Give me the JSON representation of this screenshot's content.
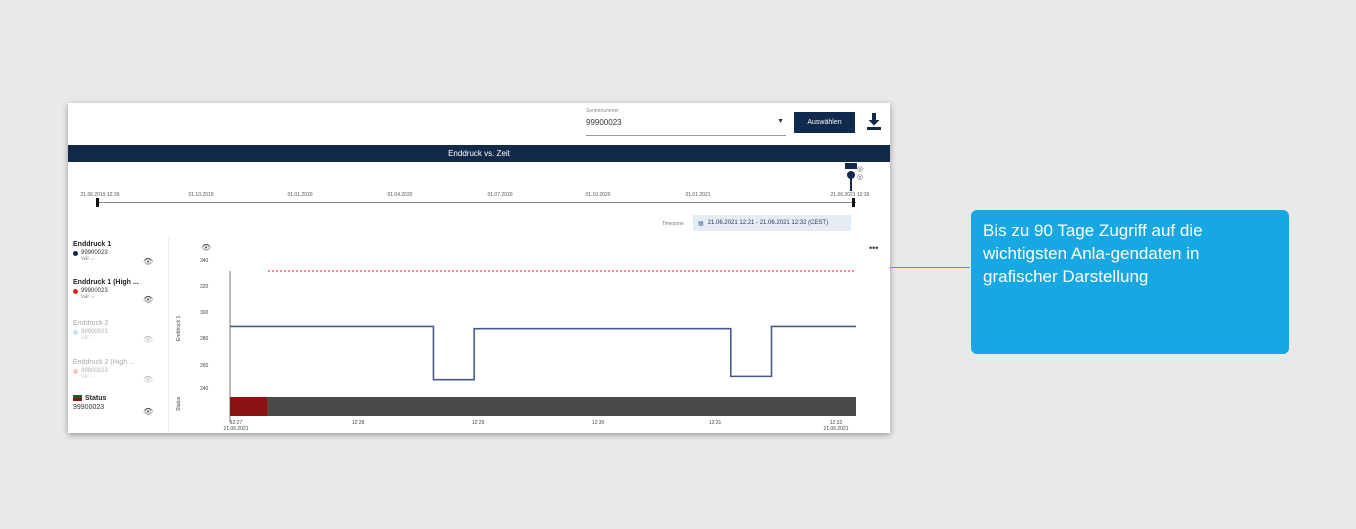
{
  "header": {
    "serial_label": "Seriennummer",
    "serial_value": "99900023",
    "select_button": "Auswählen",
    "download_icon": "download-icon"
  },
  "chart_title": "Enddruck vs. Zeit",
  "timeline": {
    "ticks": [
      "21.06.2019 12:39",
      "01.10.2019",
      "01.01.2020",
      "01.04.2020",
      "01.07.2020",
      "01.10.2020",
      "01.01.2021",
      "21.06.2021 12:39"
    ],
    "timezone_label": "Timezone",
    "range": "21.06.2021 12:21 - 21.06.2021 12:32 (CEST)"
  },
  "legend": {
    "items": [
      {
        "title": "Enddruck 1",
        "serial": "99900023",
        "sub": "val",
        "color": "#0f2a4d",
        "active": true
      },
      {
        "title": "Enddruck 1 (High ...",
        "serial": "99900023",
        "sub": "val",
        "color": "#e0261b",
        "active": true
      },
      {
        "title": "Enddruck 2",
        "serial": "99900023",
        "sub": "val",
        "color": "#6fb7e0",
        "active": false
      },
      {
        "title": "Enddruck 2 (High ...",
        "serial": "99900023",
        "sub": "val",
        "color": "#e86a6a",
        "active": false
      }
    ],
    "status": {
      "title": "Status",
      "serial": "99900023"
    }
  },
  "chart_data": {
    "type": "line",
    "ylabel": "Enddruck 1",
    "status_label": "Status",
    "yticks": [
      "240",
      "260",
      "280",
      "300",
      "320",
      "340"
    ],
    "xticks": [
      {
        "label": "12:27",
        "date": "21.06.2021"
      },
      {
        "label": "12:28",
        "date": ""
      },
      {
        "label": "12:29",
        "date": ""
      },
      {
        "label": "12:30",
        "date": ""
      },
      {
        "label": "12:31",
        "date": ""
      },
      {
        "label": "12:32",
        "date": "21.06.2021"
      }
    ],
    "ylim": [
      240,
      350
    ],
    "threshold": 350,
    "series": [
      {
        "color": "#4a5a8a",
        "points": [
          {
            "t": 0.0,
            "v": 300
          },
          {
            "t": 0.325,
            "v": 300
          },
          {
            "t": 0.325,
            "v": 252
          },
          {
            "t": 0.39,
            "v": 252
          },
          {
            "t": 0.39,
            "v": 298
          },
          {
            "t": 0.8,
            "v": 298
          },
          {
            "t": 0.8,
            "v": 255
          },
          {
            "t": 0.865,
            "v": 255
          },
          {
            "t": 0.865,
            "v": 300
          },
          {
            "t": 1.0,
            "v": 300
          }
        ]
      }
    ],
    "status_segments": [
      {
        "from": 0.0,
        "to": 0.06,
        "color": "#8b1212"
      },
      {
        "from": 0.06,
        "to": 1.0,
        "color": "#4a4a4a"
      }
    ]
  },
  "callout": {
    "text": "Bis zu 90 Tage Zugriff auf die wichtigsten Anla-gendaten in grafischer Darstellung"
  }
}
